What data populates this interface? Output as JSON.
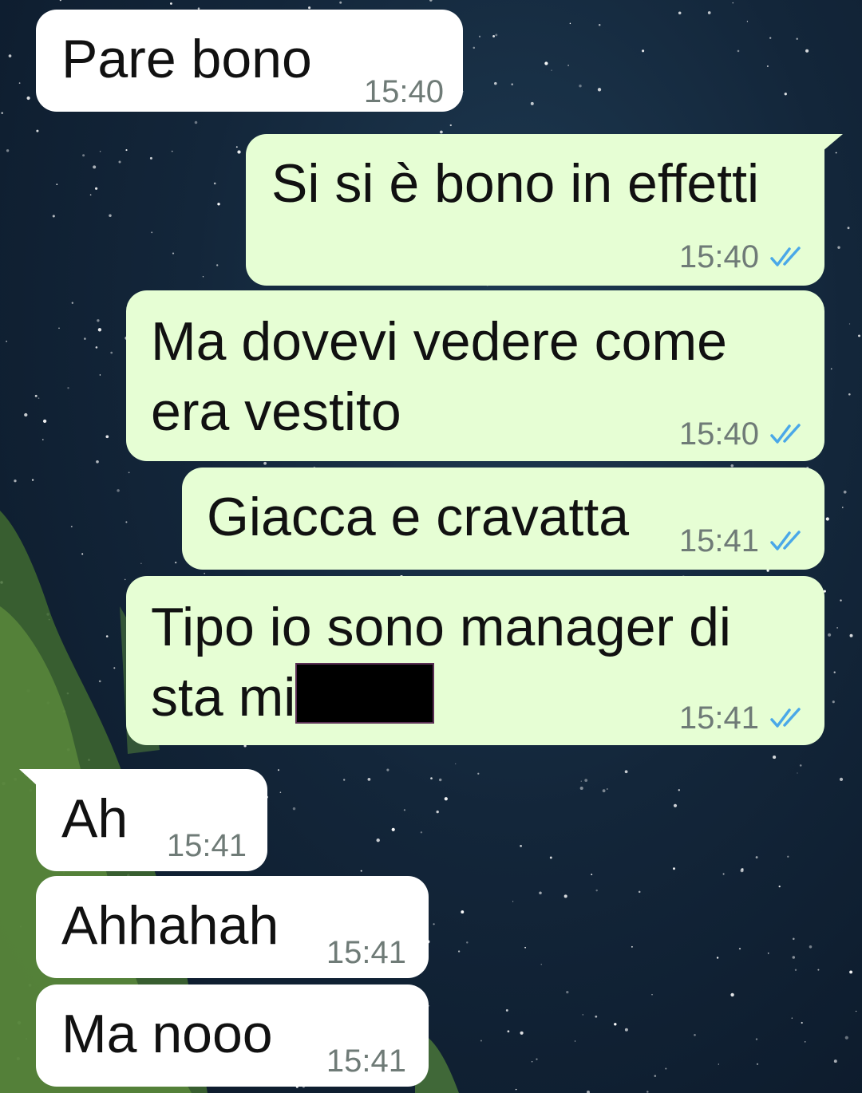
{
  "background": {
    "sky_color": "#13263a",
    "tree_color": "#4c7a3a",
    "bubble_in_color": "#ffffff",
    "bubble_out_color": "#e6fed4",
    "tick_color": "#4aa8e8"
  },
  "messages": [
    {
      "direction": "in",
      "text": "Pare bono",
      "time": "15:40"
    },
    {
      "direction": "out",
      "text": "Si si è bono in effetti",
      "time": "15:40",
      "status": "read"
    },
    {
      "direction": "out",
      "line1": "Ma dovevi vedere come",
      "line2": "era vestito",
      "time": "15:40",
      "status": "read"
    },
    {
      "direction": "out",
      "text": "Giacca e cravatta",
      "time": "15:41",
      "status": "read"
    },
    {
      "direction": "out",
      "line1": "Tipo io sono manager di",
      "line2": "sta mi",
      "redacted": true,
      "time": "15:41",
      "status": "read"
    },
    {
      "direction": "in",
      "text": "Ah",
      "time": "15:41"
    },
    {
      "direction": "in",
      "text": "Ahhahah",
      "time": "15:41"
    },
    {
      "direction": "in",
      "text": "Ma nooo",
      "time": "15:41"
    }
  ]
}
